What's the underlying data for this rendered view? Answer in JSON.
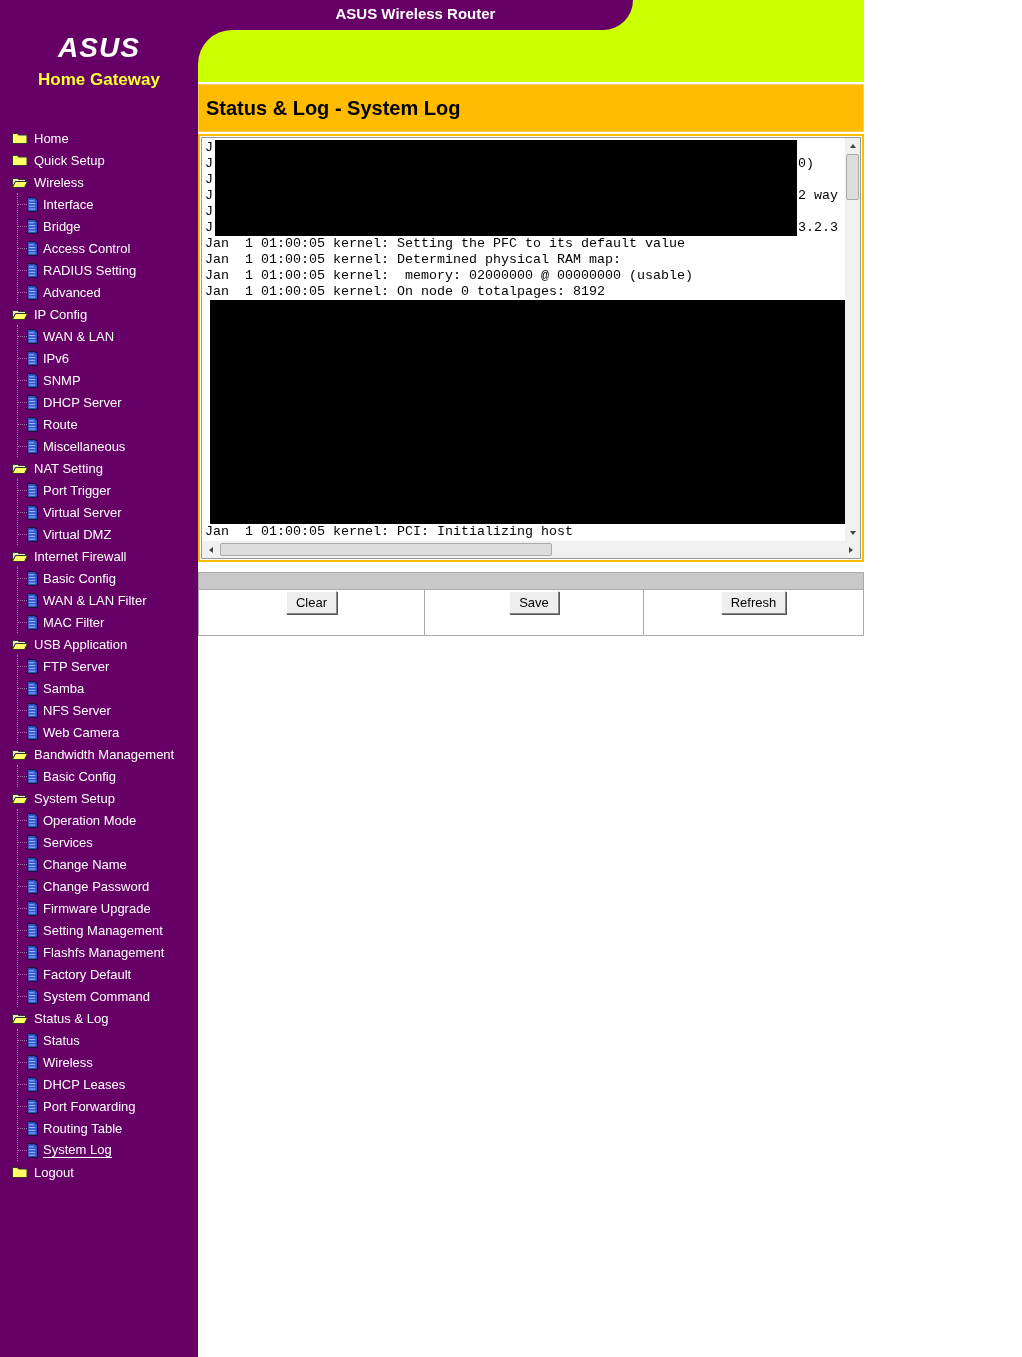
{
  "header": {
    "title": "ASUS Wireless Router",
    "logo": "ASUS",
    "subtitle": "Home Gateway"
  },
  "sidebar": {
    "items": [
      {
        "label": "Home",
        "kind": "folder",
        "selected": false
      },
      {
        "label": "Quick Setup",
        "kind": "folder",
        "selected": false
      },
      {
        "label": "Wireless",
        "kind": "folder",
        "selected": false,
        "children": [
          {
            "label": "Interface",
            "kind": "page",
            "selected": false
          },
          {
            "label": "Bridge",
            "kind": "page",
            "selected": false
          },
          {
            "label": "Access Control",
            "kind": "page",
            "selected": false
          },
          {
            "label": "RADIUS Setting",
            "kind": "page",
            "selected": false
          },
          {
            "label": "Advanced",
            "kind": "page",
            "selected": false
          }
        ]
      },
      {
        "label": "IP Config",
        "kind": "folder",
        "selected": false,
        "children": [
          {
            "label": "WAN & LAN",
            "kind": "page",
            "selected": false
          },
          {
            "label": "IPv6",
            "kind": "page",
            "selected": false
          },
          {
            "label": "SNMP",
            "kind": "page",
            "selected": false
          },
          {
            "label": "DHCP Server",
            "kind": "page",
            "selected": false
          },
          {
            "label": "Route",
            "kind": "page",
            "selected": false
          },
          {
            "label": "Miscellaneous",
            "kind": "page",
            "selected": false
          }
        ]
      },
      {
        "label": "NAT Setting",
        "kind": "folder",
        "selected": false,
        "children": [
          {
            "label": "Port Trigger",
            "kind": "page",
            "selected": false
          },
          {
            "label": "Virtual Server",
            "kind": "page",
            "selected": false
          },
          {
            "label": "Virtual DMZ",
            "kind": "page",
            "selected": false
          }
        ]
      },
      {
        "label": "Internet Firewall",
        "kind": "folder",
        "selected": false,
        "children": [
          {
            "label": "Basic Config",
            "kind": "page",
            "selected": false
          },
          {
            "label": "WAN & LAN Filter",
            "kind": "page",
            "selected": false
          },
          {
            "label": "MAC Filter",
            "kind": "page",
            "selected": false
          }
        ]
      },
      {
        "label": "USB Application",
        "kind": "folder",
        "selected": false,
        "children": [
          {
            "label": "FTP Server",
            "kind": "page",
            "selected": false
          },
          {
            "label": "Samba",
            "kind": "page",
            "selected": false
          },
          {
            "label": "NFS Server",
            "kind": "page",
            "selected": false
          },
          {
            "label": "Web Camera",
            "kind": "page",
            "selected": false
          }
        ]
      },
      {
        "label": "Bandwidth Management",
        "kind": "folder",
        "selected": false,
        "children": [
          {
            "label": "Basic Config",
            "kind": "page",
            "selected": false
          }
        ]
      },
      {
        "label": "System Setup",
        "kind": "folder",
        "selected": false,
        "children": [
          {
            "label": "Operation Mode",
            "kind": "page",
            "selected": false
          },
          {
            "label": "Services",
            "kind": "page",
            "selected": false
          },
          {
            "label": "Change Name",
            "kind": "page",
            "selected": false
          },
          {
            "label": "Change Password",
            "kind": "page",
            "selected": false
          },
          {
            "label": "Firmware Upgrade",
            "kind": "page",
            "selected": false
          },
          {
            "label": "Setting Management",
            "kind": "page",
            "selected": false
          },
          {
            "label": "Flashfs Management",
            "kind": "page",
            "selected": false
          },
          {
            "label": "Factory Default",
            "kind": "page",
            "selected": false
          },
          {
            "label": "System Command",
            "kind": "page",
            "selected": false
          }
        ]
      },
      {
        "label": "Status & Log",
        "kind": "folder",
        "selected": false,
        "children": [
          {
            "label": "Status",
            "kind": "page",
            "selected": false
          },
          {
            "label": "Wireless",
            "kind": "page",
            "selected": false
          },
          {
            "label": "DHCP Leases",
            "kind": "page",
            "selected": false
          },
          {
            "label": "Port Forwarding",
            "kind": "page",
            "selected": false
          },
          {
            "label": "Routing Table",
            "kind": "page",
            "selected": false
          },
          {
            "label": "System Log",
            "kind": "page",
            "selected": true
          }
        ]
      },
      {
        "label": "Logout",
        "kind": "folder",
        "selected": false
      }
    ]
  },
  "page_title": "Status & Log - System Log",
  "log": {
    "lines": [
      {
        "kind": "redacted",
        "prefix": "J"
      },
      {
        "kind": "redacted",
        "prefix": "J",
        "tail": "0)"
      },
      {
        "kind": "redacted",
        "prefix": "J"
      },
      {
        "kind": "redacted",
        "prefix": "J",
        "tail": "2 way"
      },
      {
        "kind": "redacted",
        "prefix": "J"
      },
      {
        "kind": "redacted",
        "prefix": "J",
        "tail": "3.2.3"
      },
      {
        "kind": "text",
        "text": "Jan  1 01:00:05 kernel: Setting the PFC to its default value"
      },
      {
        "kind": "text",
        "text": "Jan  1 01:00:05 kernel: Determined physical RAM map:"
      },
      {
        "kind": "text",
        "text": "Jan  1 01:00:05 kernel:  memory: 02000000 @ 00000000 (usable)"
      },
      {
        "kind": "text",
        "text": "Jan  1 01:00:05 kernel: On node 0 totalpages: 8192"
      },
      {
        "kind": "blocked"
      },
      {
        "kind": "blocked"
      },
      {
        "kind": "blocked"
      },
      {
        "kind": "blocked"
      },
      {
        "kind": "blocked"
      },
      {
        "kind": "blocked"
      },
      {
        "kind": "blocked"
      },
      {
        "kind": "blocked"
      },
      {
        "kind": "blocked"
      },
      {
        "kind": "blocked"
      },
      {
        "kind": "blocked"
      },
      {
        "kind": "blocked"
      },
      {
        "kind": "blocked"
      },
      {
        "kind": "blocked"
      },
      {
        "kind": "text",
        "text": "Jan  1 01:00:05 kernel: PCI: Initializing host"
      }
    ]
  },
  "buttons": [
    "Clear",
    "Save",
    "Refresh"
  ]
}
